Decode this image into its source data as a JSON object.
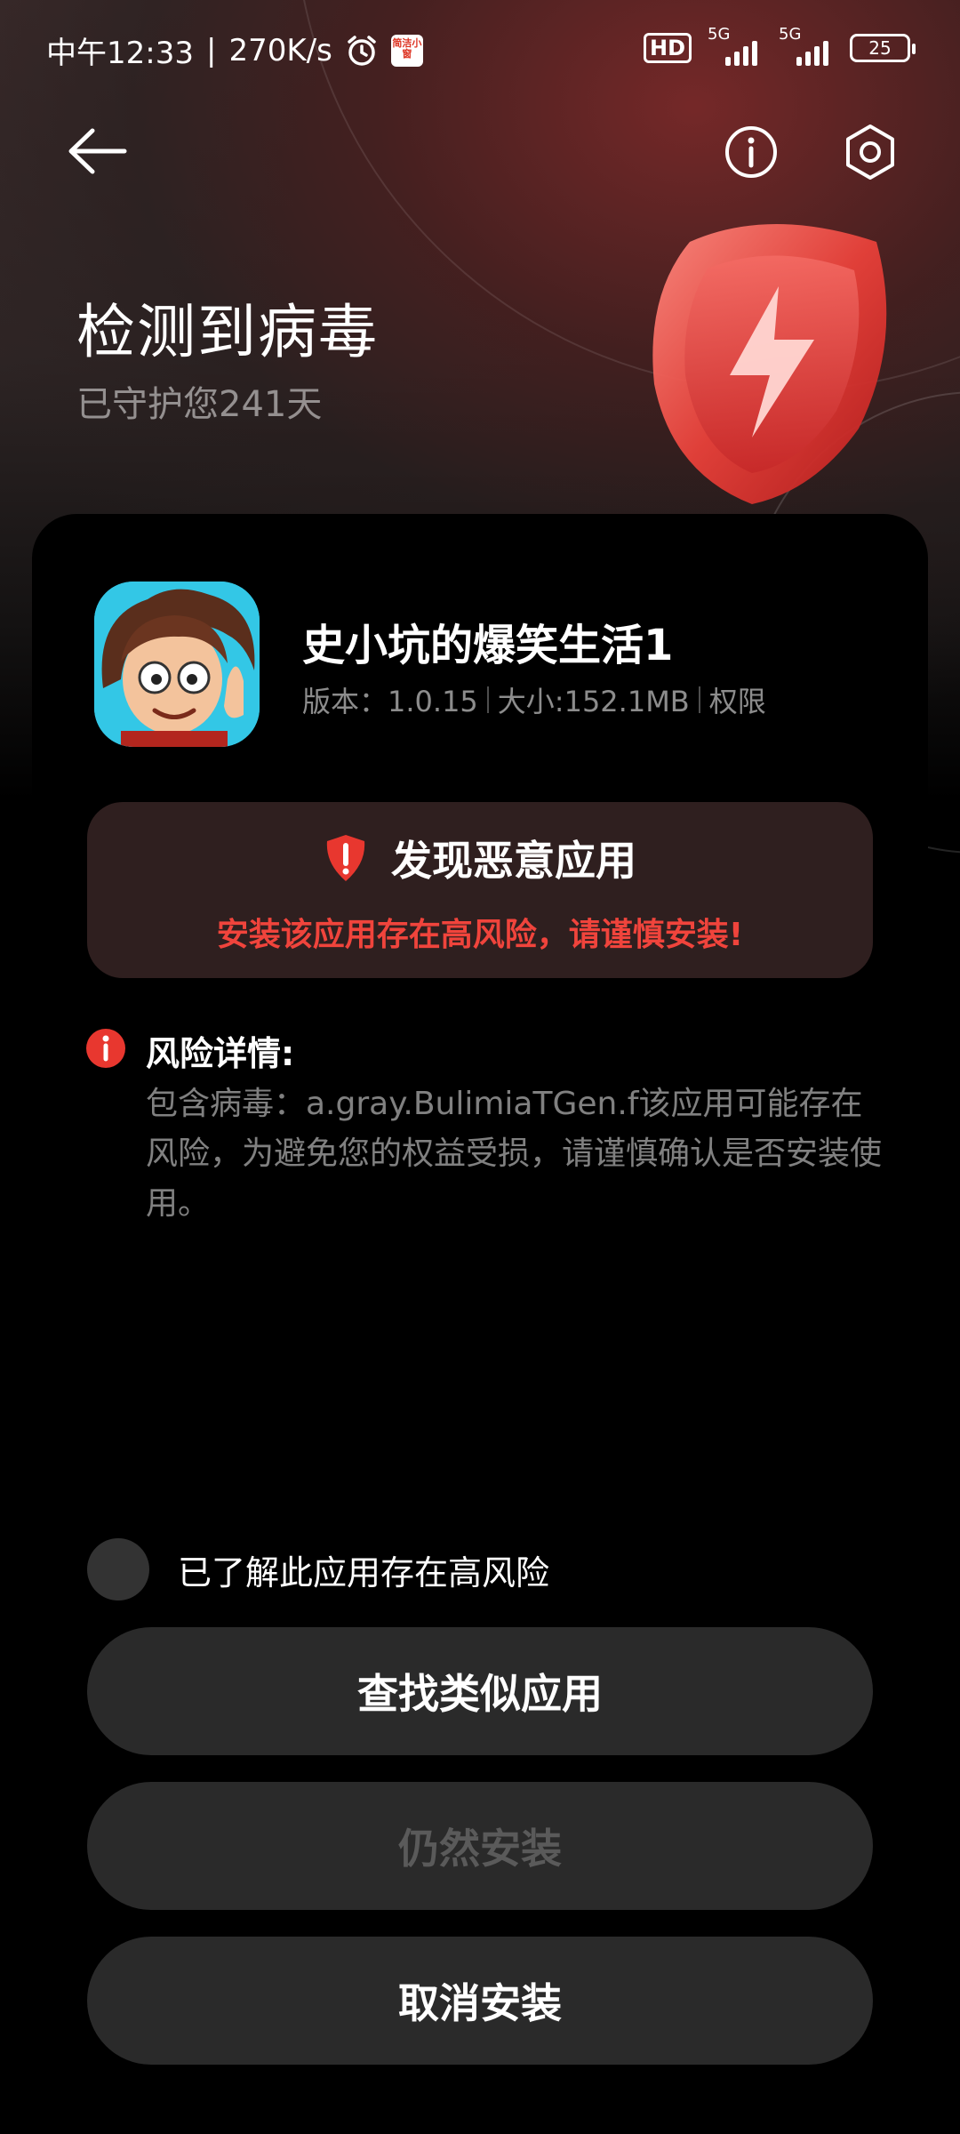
{
  "status_bar": {
    "time": "中午12:33",
    "net_speed": "270K/s",
    "app_badge": "简洁小窗",
    "hd": "HD",
    "sim1": "5G",
    "sim2": "5G",
    "battery": "25"
  },
  "hero": {
    "title": "检测到病毒",
    "subtitle": "已守护您241天"
  },
  "app": {
    "name": "史小坑的爆笑生活1",
    "version": "版本：1.0.15",
    "size": "大小:152.1MB",
    "permissions": "权限"
  },
  "warning": {
    "title": "发现恶意应用",
    "subtitle": "安装该应用存在高风险，请谨慎安装!"
  },
  "risk": {
    "title": "风险详情:",
    "description": "包含病毒：a.gray.BulimiaTGen.f该应用可能存在风险，为避免您的权益受损，请谨慎确认是否安装使用。"
  },
  "ack": {
    "label": "已了解此应用存在高风险"
  },
  "buttons": {
    "find_similar": "查找类似应用",
    "install_anyway": "仍然安装",
    "cancel_install": "取消安装"
  },
  "colors": {
    "accent_red": "#f0443c",
    "warn_bg": "#2f1f1f",
    "button_bg": "#2a2a2a"
  }
}
